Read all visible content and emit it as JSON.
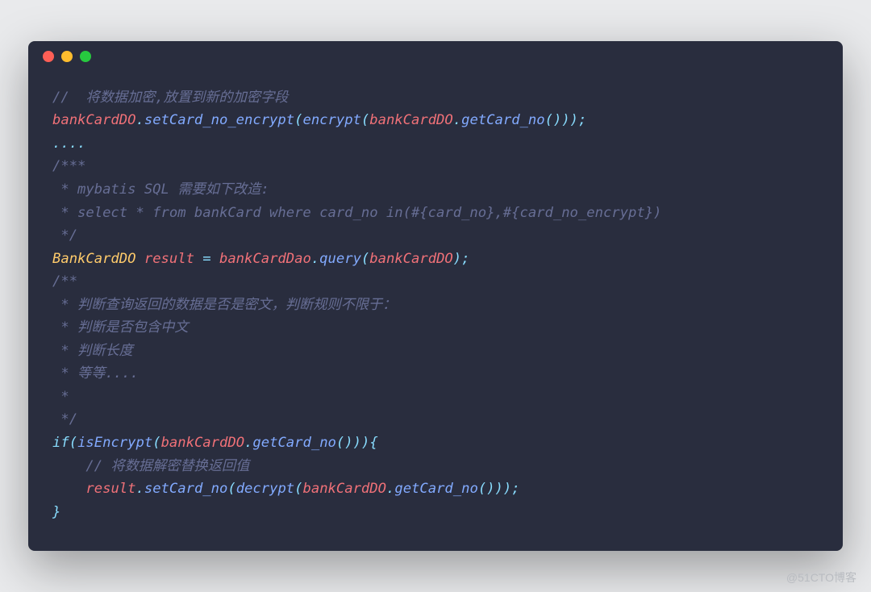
{
  "titlebar": {
    "dots": [
      "red",
      "yellow",
      "green"
    ]
  },
  "code": {
    "l1_comment": "//  将数据加密,放置到新的加密字段",
    "l2_var1": "bankCardDO",
    "l2_dot1": ".",
    "l2_method1": "setCard_no_encrypt",
    "l2_p1": "(",
    "l2_method2": "encrypt",
    "l2_p2": "(",
    "l2_var2": "bankCardDO",
    "l2_dot2": ".",
    "l2_method3": "getCard_no",
    "l2_p3": "(",
    "l2_p4": ")",
    "l2_p5": ")",
    "l2_p6": ")",
    "l2_semi": ";",
    "l3_ellipsis": "....",
    "l4_c": "/***",
    "l5_c": " * mybatis SQL 需要如下改造:",
    "l6_c": " * select * from bankCard where card_no in(#{card_no},#{card_no_encrypt})",
    "l7_c": " */",
    "l8_type": "BankCardDO",
    "l8_var1": "result",
    "l8_eq": " = ",
    "l8_var2": "bankCardDao",
    "l8_dot": ".",
    "l8_method": "query",
    "l8_p1": "(",
    "l8_arg": "bankCardDO",
    "l8_p2": ")",
    "l8_semi": ";",
    "l9_c": "/**",
    "l10_c": " * 判断查询返回的数据是否是密文，判断规则不限于：",
    "l11_c": " * 判断是否包含中文",
    "l12_c": " * 判断长度",
    "l13_c": " * 等等....",
    "l14_c": " *",
    "l15_c": " */",
    "l16_if": "if",
    "l16_p1": "(",
    "l16_method1": "isEncrypt",
    "l16_p2": "(",
    "l16_var": "bankCardDO",
    "l16_dot": ".",
    "l16_method2": "getCard_no",
    "l16_p3": "(",
    "l16_p4": ")",
    "l16_p5": ")",
    "l16_p6": ")",
    "l16_brace": "{",
    "l17_c": "    // 将数据解密替换返回值",
    "l18_indent": "    ",
    "l18_var1": "result",
    "l18_dot1": ".",
    "l18_method1": "setCard_no",
    "l18_p1": "(",
    "l18_method2": "decrypt",
    "l18_p2": "(",
    "l18_var2": "bankCardDO",
    "l18_dot2": ".",
    "l18_method3": "getCard_no",
    "l18_p3": "(",
    "l18_p4": ")",
    "l18_p5": ")",
    "l18_p6": ")",
    "l18_semi": ";",
    "l19_brace": "}"
  },
  "watermark": "@51CTO博客"
}
